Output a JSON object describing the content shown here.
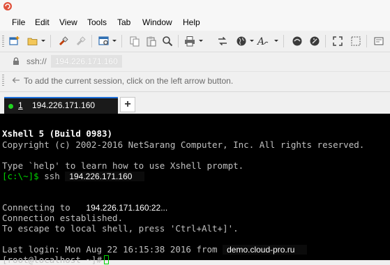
{
  "menu": {
    "items": [
      "File",
      "Edit",
      "View",
      "Tools",
      "Tab",
      "Window",
      "Help"
    ]
  },
  "toolbar": {
    "buttons": [
      "new-session",
      "open",
      "reconnect",
      "disconnect",
      "properties",
      "copy",
      "paste",
      "find",
      "print",
      "transfer",
      "globe",
      "font",
      "xftp",
      "xmanager",
      "fullscreen",
      "transparency",
      "compose"
    ]
  },
  "address": {
    "prefix": "ssh://",
    "host": "194.226.171.160"
  },
  "hint": {
    "text": "To add the current session, click on the left arrow button."
  },
  "tabs": [
    {
      "number": "1",
      "label": "194.226.171.160",
      "status_color": "#21d421"
    }
  ],
  "add_tab_label": "+",
  "terminal": {
    "banner_title": "Xshell 5 (Build 0983)",
    "copyright": "Copyright (c) 2002-2016 NetSarang Computer, Inc. All rights reserved.",
    "help_line": "Type `help' to learn how to use Xshell prompt.",
    "local_prompt": "[c:\\~]$",
    "local_command": "ssh",
    "ssh_host": "194.226.171.160",
    "connecting_prefix": "Connecting to",
    "connecting_target": "194.226.171.160:22...",
    "established": "Connection established.",
    "escape_hint": "To escape to local shell, press 'Ctrl+Alt+]'.",
    "last_login_prefix": "Last login: Mon Aug 22 16:15:38 2016 from",
    "last_login_host": "demo.cloud-pro.ru",
    "remote_prompt": "[root@localhost ~]#"
  },
  "colors": {
    "terminal_bg": "#000000",
    "prompt_green": "#00d700",
    "tab_accent": "#1e6fd9"
  }
}
